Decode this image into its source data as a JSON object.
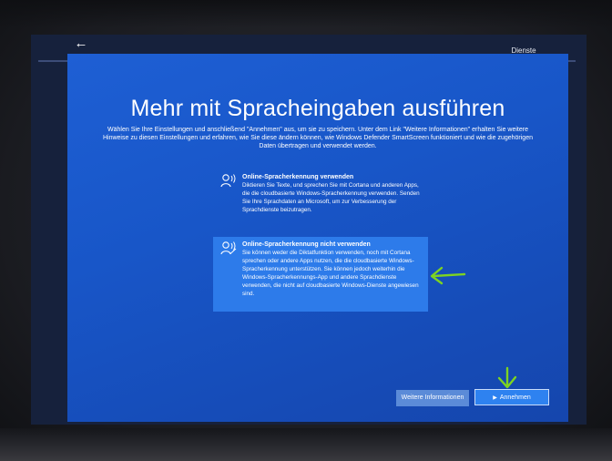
{
  "header": {
    "step_label": "Dienste"
  },
  "page": {
    "title": "Mehr mit Spracheingaben ausführen",
    "description": "Wählen Sie Ihre Einstellungen und anschließend \"Annehmen\" aus, um sie zu speichern. Unter dem Link \"Weitere Informationen\" erhalten Sie weitere Hinweise zu diesen Einstellungen und erfahren, wie Sie diese ändern können, wie Windows Defender SmartScreen funktioniert und wie die zugehörigen Daten übertragen und verwendet werden."
  },
  "options": [
    {
      "title": "Online-Spracherkennung verwenden",
      "text": "Diktieren Sie Texte, und sprechen Sie mit Cortana und anderen Apps, die die cloudbasierte Windows-Spracherkennung verwenden. Senden Sie Ihre Sprachdaten an Microsoft, um zur Verbesserung der Sprachdienste beizutragen.",
      "icon": "speech-icon",
      "selected": false
    },
    {
      "title": "Online-Spracherkennung nicht verwenden",
      "text": "Sie können weder die Diktatfunktion verwenden, noch mit Cortana sprechen oder andere Apps nutzen, die die cloudbasierte Windows-Spracherkennung unterstützen. Sie können jedoch weiterhin die Windows-Spracherkennungs-App und andere Sprachdienste verwenden, die nicht auf cloudbasierte Windows-Dienste angewiesen sind.",
      "icon": "speech-off-icon",
      "selected": true
    }
  ],
  "buttons": {
    "more_info": "Weitere Informationen",
    "accept": "Annehmen"
  },
  "colors": {
    "panel_blue": "#1856c8",
    "selected_option": "#2d7bea",
    "annotation_green": "#7ed321"
  }
}
